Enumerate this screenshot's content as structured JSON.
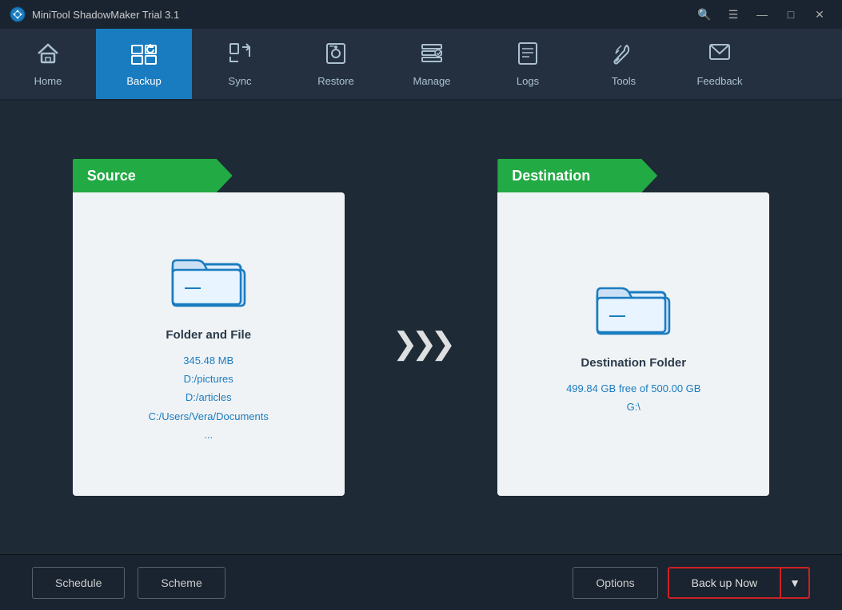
{
  "titlebar": {
    "title": "MiniTool ShadowMaker Trial 3.1",
    "logo_alt": "minitool-logo"
  },
  "navbar": {
    "items": [
      {
        "id": "home",
        "label": "Home",
        "icon": "house",
        "active": false
      },
      {
        "id": "backup",
        "label": "Backup",
        "icon": "backup",
        "active": true
      },
      {
        "id": "sync",
        "label": "Sync",
        "icon": "sync",
        "active": false
      },
      {
        "id": "restore",
        "label": "Restore",
        "icon": "restore",
        "active": false
      },
      {
        "id": "manage",
        "label": "Manage",
        "icon": "manage",
        "active": false
      },
      {
        "id": "logs",
        "label": "Logs",
        "icon": "logs",
        "active": false
      },
      {
        "id": "tools",
        "label": "Tools",
        "icon": "tools",
        "active": false
      },
      {
        "id": "feedback",
        "label": "Feedback",
        "icon": "feedback",
        "active": false
      }
    ]
  },
  "source_panel": {
    "header": "Source",
    "title": "Folder and File",
    "size": "345.48 MB",
    "paths": [
      "D:/pictures",
      "D:/articles",
      "C:/Users/Vera/Documents",
      "..."
    ]
  },
  "destination_panel": {
    "header": "Destination",
    "title": "Destination Folder",
    "free": "499.84 GB free of 500.00 GB",
    "drive": "G:\\"
  },
  "bottombar": {
    "schedule_label": "Schedule",
    "scheme_label": "Scheme",
    "options_label": "Options",
    "backup_now_label": "Back up Now",
    "dropdown_label": "▼"
  },
  "win_controls": {
    "search": "🔍",
    "menu": "☰",
    "minimize": "—",
    "maximize": "□",
    "close": "✕"
  }
}
